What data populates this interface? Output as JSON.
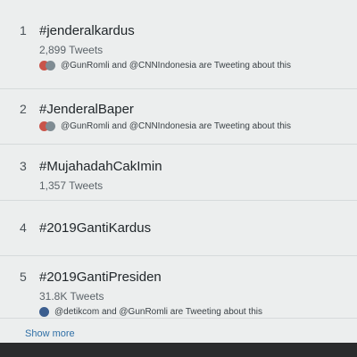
{
  "trends": [
    {
      "rank": "1",
      "tag": "#jenderalkardus",
      "count": "2,899 Tweets",
      "context": "@GunRomli and @CNNIndonesia are Tweeting about this"
    },
    {
      "rank": "2",
      "tag": "#JenderalBaper",
      "context": "@GunRomli and @CNNIndonesia are Tweeting about this"
    },
    {
      "rank": "3",
      "tag": "#MujahadahCakImin",
      "count": "1,357 Tweets"
    },
    {
      "rank": "4",
      "tag": "#2019GantiKardus"
    },
    {
      "rank": "5",
      "tag": "#2019GantiPresiden",
      "count": "31.8K Tweets",
      "context": "@detikcom and @GunRomli are Tweeting about this"
    }
  ],
  "show_more": "Show more"
}
